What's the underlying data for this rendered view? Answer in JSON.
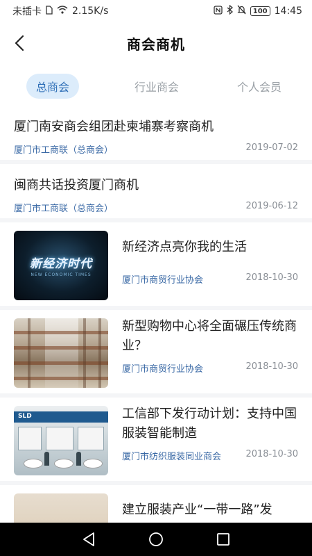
{
  "status_bar": {
    "carrier": "未插卡",
    "speed": "2.15K/s",
    "battery": "100",
    "time": "14:45"
  },
  "header": {
    "title": "商会商机"
  },
  "tabs": [
    {
      "label": "总商会",
      "active": true
    },
    {
      "label": "行业商会",
      "active": false
    },
    {
      "label": "个人会员",
      "active": false
    }
  ],
  "articles": [
    {
      "title": "厦门南安商会组团赴柬埔寨考察商机",
      "source": "厦门市工商联（总商会）",
      "date": "2019-07-02"
    },
    {
      "title": "闽商共话投资厦门商机",
      "source": "厦门市工商联（总商会）",
      "date": "2019-06-12"
    },
    {
      "title": "新经济点亮你我的生活",
      "source": "厦门市商贸行业协会",
      "date": "2018-10-30",
      "thumb": {
        "caption": "新经济时代",
        "sub": "NEW ECONOMIC TIMES"
      }
    },
    {
      "title": "新型购物中心将全面碾压传统商业？",
      "source": "厦门市商贸行业协会",
      "date": "2018-10-30"
    },
    {
      "title": "工信部下发行动计划：支持中国服装智能制造",
      "source": "厦门市纺织服装同业商会",
      "date": "2018-10-30",
      "thumb": {
        "banner": "SLD"
      }
    },
    {
      "title": "建立服装产业“一带一路”发"
    }
  ],
  "colors": {
    "accent": "#2f6fb7",
    "tab_active_bg": "#dcecfb",
    "source_text": "#3b6aa6",
    "date_text": "#8a8f96",
    "divider": "#f4f5f7"
  }
}
